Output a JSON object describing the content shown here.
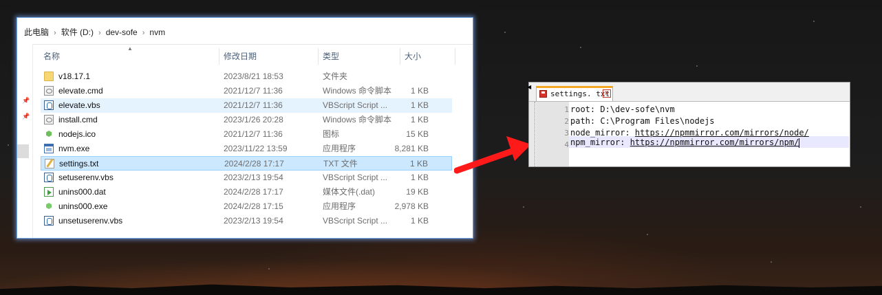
{
  "explorer": {
    "breadcrumb": [
      "此电脑",
      "软件 (D:)",
      "dev-sofe",
      "nvm"
    ],
    "columns": {
      "name": "名称",
      "date": "修改日期",
      "type": "类型",
      "size": "大小"
    },
    "files": [
      {
        "name": "v18.17.1",
        "date": "2023/8/21 18:53",
        "type": "文件夹",
        "size": "",
        "icon": "folder-icon"
      },
      {
        "name": "elevate.cmd",
        "date": "2021/12/7 11:36",
        "type": "Windows 命令脚本",
        "size": "1 KB",
        "icon": "cmd-file-icon"
      },
      {
        "name": "elevate.vbs",
        "date": "2021/12/7 11:36",
        "type": "VBScript Script ...",
        "size": "1 KB",
        "icon": "vbs-file-icon"
      },
      {
        "name": "install.cmd",
        "date": "2023/1/26 20:28",
        "type": "Windows 命令脚本",
        "size": "1 KB",
        "icon": "cmd-file-icon"
      },
      {
        "name": "nodejs.ico",
        "date": "2021/12/7 11:36",
        "type": "图标",
        "size": "15 KB",
        "icon": "nodejs-icon"
      },
      {
        "name": "nvm.exe",
        "date": "2023/11/22 13:59",
        "type": "应用程序",
        "size": "8,281 KB",
        "icon": "exe-file-icon"
      },
      {
        "name": "settings.txt",
        "date": "2024/2/28 17:17",
        "type": "TXT 文件",
        "size": "1 KB",
        "icon": "txt-file-icon"
      },
      {
        "name": "setuserenv.vbs",
        "date": "2023/2/13 19:54",
        "type": "VBScript Script ...",
        "size": "1 KB",
        "icon": "vbs-file-icon"
      },
      {
        "name": "unins000.dat",
        "date": "2024/2/28 17:17",
        "type": "媒体文件(.dat)",
        "size": "19 KB",
        "icon": "media-file-icon"
      },
      {
        "name": "unins000.exe",
        "date": "2024/2/28 17:15",
        "type": "应用程序",
        "size": "2,978 KB",
        "icon": "installer-icon"
      },
      {
        "name": "unsetuserenv.vbs",
        "date": "2023/2/13 19:54",
        "type": "VBScript Script ...",
        "size": "1 KB",
        "icon": "vbs-file-icon"
      }
    ],
    "hover_row": "elevate.vbs",
    "selected_row": "settings.txt",
    "accent": "#cce8ff"
  },
  "notepad": {
    "tab_title": "settings. txt",
    "line_numbers": [
      "1",
      "2",
      "3",
      "4"
    ],
    "lines": [
      {
        "prefix": "root: D:\\dev-sofe\\nvm",
        "url": ""
      },
      {
        "prefix": "path: C:\\Program Files\\nodejs",
        "url": ""
      },
      {
        "prefix": "node_mirror: ",
        "url": "https://npmmirror.com/mirrors/node/"
      },
      {
        "prefix": "npm_mirror: ",
        "url": "https://npmmirror.com/mirrors/npm/"
      }
    ],
    "tab_accent": "#f5a623"
  },
  "arrow_color": "#ff1a1a"
}
